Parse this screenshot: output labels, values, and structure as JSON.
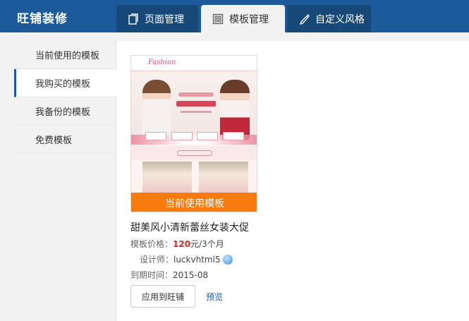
{
  "app": {
    "title": "旺铺装修"
  },
  "tabs": [
    {
      "label": "页面管理",
      "icon": "page-icon",
      "active": false
    },
    {
      "label": "模板管理",
      "icon": "grid-icon",
      "active": true
    },
    {
      "label": "自定义风格",
      "icon": "brush-icon",
      "active": false
    }
  ],
  "sidebar": {
    "items": [
      {
        "label": "当前使用的模板",
        "active": false
      },
      {
        "label": "我购买的模板",
        "active": true
      },
      {
        "label": "我备份的模板",
        "active": false
      },
      {
        "label": "免费模板",
        "active": false
      }
    ]
  },
  "template": {
    "thumbnail_logo": "Fashion",
    "overlay_label": "当前使用模板",
    "name": "甜美风小清新蕾丝女装大促",
    "price_label": "模板价格：",
    "price_value": "120",
    "price_unit": "元/3个月",
    "designer_label": "设计师：",
    "designer_value": "luckvhtml5",
    "designer_icon": "qq-icon",
    "expire_label": "到期时间：",
    "expire_value": "2015-08",
    "apply_label": "应用到旺铺",
    "preview_label": "预览"
  },
  "colors": {
    "header_bg": "#1d5a9a",
    "tab_bg": "#164878",
    "overlay_orange": "#f97b0d",
    "price_red": "#d8261c"
  }
}
